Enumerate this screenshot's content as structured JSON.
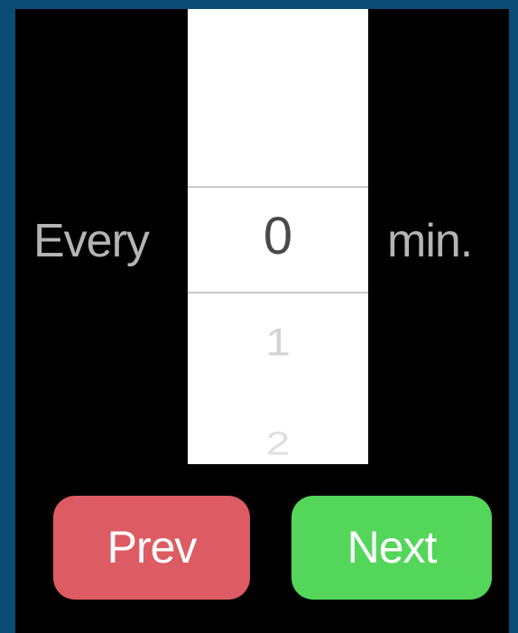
{
  "picker": {
    "prefix_label": "Every",
    "suffix_label": "min.",
    "selected_value": "0",
    "next_values": [
      "1",
      "2"
    ]
  },
  "buttons": {
    "prev_label": "Prev",
    "next_label": "Next"
  },
  "colors": {
    "frame_bg": "#0a4c75",
    "screen_bg": "#000000",
    "prev_button": "#dd5b62",
    "next_button": "#53d65a",
    "picker_bg": "#ffffff"
  }
}
